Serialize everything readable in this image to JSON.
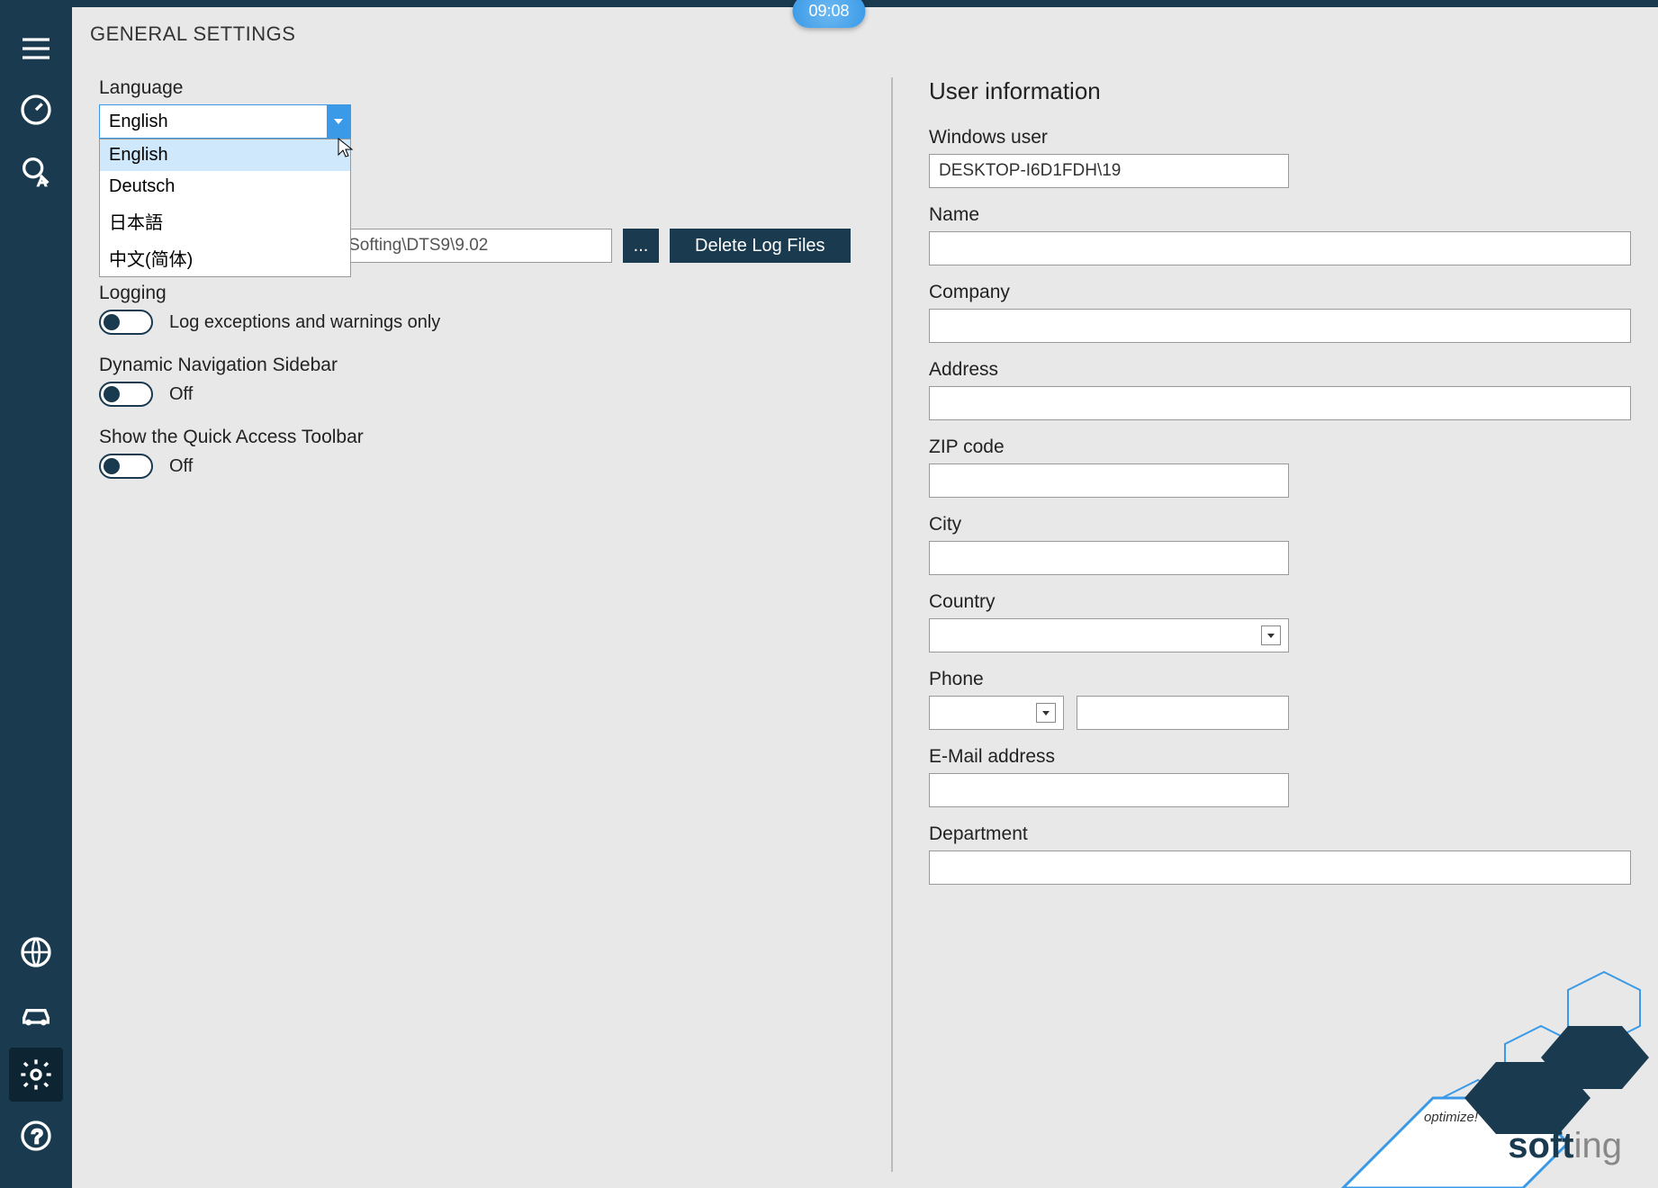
{
  "time": "09:08",
  "page_title": "GENERAL SETTINGS",
  "left": {
    "language_label": "Language",
    "language_value": "English",
    "language_options": [
      "English",
      "Deutsch",
      "日本語",
      "中文(简体)"
    ],
    "log_path": "C:\\Users\\19\\AppData\\Roaming\\Softing\\DTS9\\9.02",
    "browse_label": "...",
    "delete_log_label": "Delete Log Files",
    "logging_label": "Logging",
    "logging_value": "Log exceptions and warnings only",
    "dyn_nav_label": "Dynamic Navigation Sidebar",
    "dyn_nav_value": "Off",
    "quick_toolbar_label": "Show the Quick Access Toolbar",
    "quick_toolbar_value": "Off"
  },
  "right": {
    "section_title": "User information",
    "windows_user_label": "Windows user",
    "windows_user_value": "DESKTOP-I6D1FDH\\19",
    "name_label": "Name",
    "name_value": "",
    "company_label": "Company",
    "company_value": "",
    "address_label": "Address",
    "address_value": "",
    "zip_label": "ZIP code",
    "zip_value": "",
    "city_label": "City",
    "city_value": "",
    "country_label": "Country",
    "country_value": "",
    "phone_label": "Phone",
    "phone_prefix": "",
    "phone_value": "",
    "email_label": "E-Mail address",
    "email_value": "",
    "department_label": "Department",
    "department_value": ""
  },
  "logo": {
    "optimize": "optimize!",
    "brand1": "soft",
    "brand2": "ing"
  }
}
